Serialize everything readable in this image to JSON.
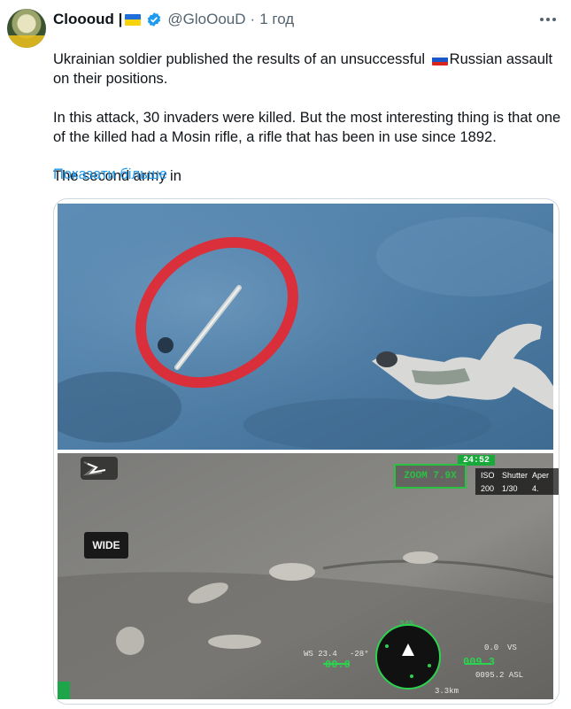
{
  "tweet": {
    "author_name": "Cloooud |",
    "author_flag": "ukraine-flag-icon",
    "handle": "@GloOouD",
    "separator": "·",
    "time": "1 год",
    "line1_part1": "Ukrainian soldier published the results of an unsuccessful ",
    "line1_part2": "Russian assault on their positions.",
    "paragraph2": "In this attack, 30 invaders were killed. But the most interesting thing is that one of the killed had a Mosin rifle, a rifle that has been in use since 1892.",
    "paragraph3": "The second army in",
    "show_more": "Показати більше"
  },
  "media": {
    "image1_alt": "Drone photo of a rifle circled in red next to a body on the ground",
    "hud": {
      "wide": "WIDE",
      "zoom": "ZOOM 7.9X",
      "timer": "24:52",
      "iso_label": "ISO",
      "iso_value": "200",
      "shutter_label": "Shutter",
      "shutter_value": "1/30",
      "aperture_label": "Aper",
      "aperture_value": "4.",
      "ws": "WS 23.4",
      "angle": "-28°",
      "speed": "00.0",
      "alt": "009.3",
      "asl": "0095.2 ASL",
      "vs": "0.0",
      "vs_label": "VS",
      "dist": "3.3km",
      "heading": "340"
    }
  },
  "colors": {
    "link": "#1d9bf0",
    "verified": "#1d9bf0",
    "hud_green": "#2bd34e",
    "circle_red": "#e8262f"
  }
}
